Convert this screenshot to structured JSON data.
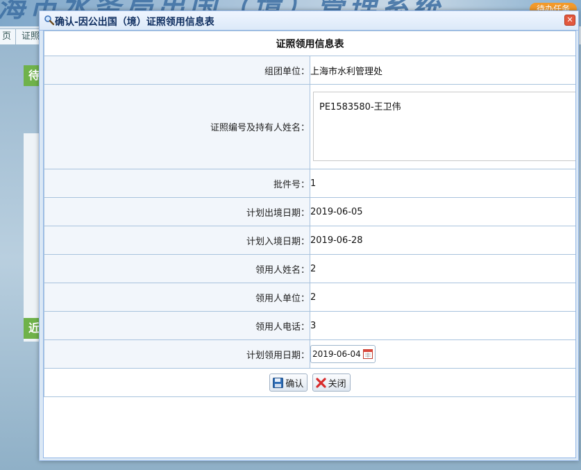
{
  "background": {
    "banner_title": "海市水务局出国（境）管理系统",
    "badge": "待办任务",
    "tabs": [
      "页",
      "证照"
    ],
    "side_badges": [
      "待",
      "近"
    ]
  },
  "dialog": {
    "title": "确认-因公出国（境）证照领用信息表",
    "table_caption": "证照领用信息表",
    "fields": [
      {
        "label": "组团单位：",
        "value": "上海市水利管理处"
      },
      {
        "label": "证照编号及持有人姓名：",
        "value": "PE1583580-王卫伟"
      },
      {
        "label": "批件号：",
        "value": "1"
      },
      {
        "label": "计划出境日期：",
        "value": "2019-06-05"
      },
      {
        "label": "计划入境日期：",
        "value": "2019-06-28"
      },
      {
        "label": "领用人姓名：",
        "value": "2"
      },
      {
        "label": "领用人单位：",
        "value": "2"
      },
      {
        "label": "领用人电话：",
        "value": "3"
      },
      {
        "label": "计划领用日期：",
        "value": "2019-06-04"
      }
    ],
    "buttons": {
      "confirm": "确认",
      "close": "关闭"
    }
  },
  "colors": {
    "header_bg": "#dce9f8",
    "border": "#95b8e7",
    "label_bg": "#f2f6fb",
    "close_red": "#e2583e"
  }
}
